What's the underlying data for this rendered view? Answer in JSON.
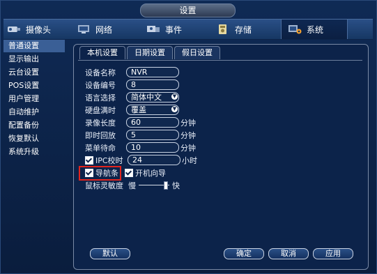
{
  "window": {
    "title": "设置"
  },
  "topnav": {
    "items": [
      {
        "label": "摄像头",
        "icon": "camera-icon"
      },
      {
        "label": "网络",
        "icon": "network-icon"
      },
      {
        "label": "事件",
        "icon": "event-icon"
      },
      {
        "label": "存储",
        "icon": "storage-icon"
      },
      {
        "label": "系统",
        "icon": "system-icon",
        "active": true
      }
    ]
  },
  "sidebar": {
    "items": [
      {
        "label": "普通设置",
        "active": true
      },
      {
        "label": "显示输出"
      },
      {
        "label": "云台设置"
      },
      {
        "label": "POS设置"
      },
      {
        "label": "用户管理"
      },
      {
        "label": "自动维护"
      },
      {
        "label": "配置备份"
      },
      {
        "label": "恢复默认"
      },
      {
        "label": "系统升级"
      }
    ]
  },
  "tabs": [
    {
      "label": "本机设置",
      "active": true
    },
    {
      "label": "日期设置"
    },
    {
      "label": "假日设置"
    }
  ],
  "form": {
    "device_name": {
      "label": "设备名称",
      "value": "NVR"
    },
    "device_no": {
      "label": "设备编号",
      "value": "8"
    },
    "language": {
      "label": "语言选择",
      "value": "简体中文"
    },
    "disk_full": {
      "label": "硬盘满时",
      "value": "覆盖"
    },
    "record_len": {
      "label": "录像长度",
      "value": "60",
      "unit": "分钟"
    },
    "instant_playback": {
      "label": "即时回放",
      "value": "5",
      "unit": "分钟"
    },
    "menu_standby": {
      "label": "菜单待命",
      "value": "10",
      "unit": "分钟"
    },
    "ipc_sync": {
      "label": "IPC校时",
      "value": "24",
      "unit": "小时",
      "checked": true
    },
    "nav_bar": {
      "label": "导航条",
      "checked": true
    },
    "startup_wizard": {
      "label": "开机向导",
      "checked": true
    },
    "mouse_sensitivity": {
      "label": "鼠标灵敏度",
      "slow": "慢",
      "fast": "快",
      "level": 0.9
    }
  },
  "buttons": {
    "default": "默认",
    "ok": "确定",
    "cancel": "取消",
    "apply": "应用"
  },
  "colors": {
    "highlight": "#e2241e",
    "active_side": "#3a5f96"
  }
}
